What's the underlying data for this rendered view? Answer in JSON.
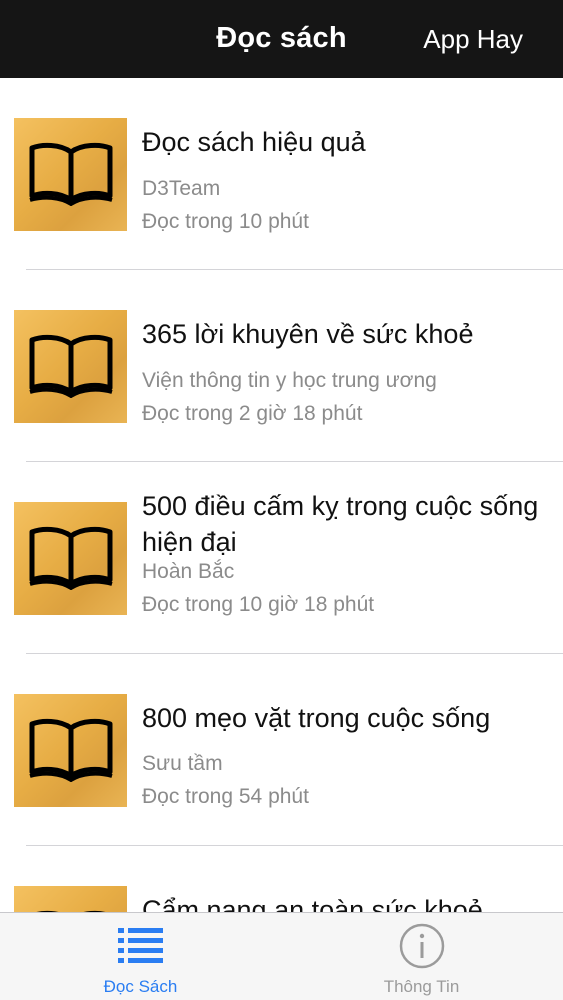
{
  "navbar": {
    "title": "Đọc sách",
    "right_button": "App Hay"
  },
  "books": [
    {
      "title": "Đọc sách hiệu quả",
      "author": "D3Team",
      "duration": "Đọc trong 10 phút",
      "cover_icon": "open-book-icon"
    },
    {
      "title": "365 lời khuyên về sức khoẻ",
      "author": "Viện thông tin y học trung ương",
      "duration": "Đọc trong 2 giờ 18 phút",
      "cover_icon": "open-book-icon"
    },
    {
      "title": "500 điều cấm kỵ trong cuộc sống hiện đại",
      "author": "Hoàn Bắc",
      "duration": "Đọc trong 10 giờ 18 phút",
      "cover_icon": "open-book-icon"
    },
    {
      "title": "800 mẹo vặt trong cuộc sống",
      "author": "Sưu tầm",
      "duration": "Đọc trong 54 phút",
      "cover_icon": "open-book-icon"
    },
    {
      "title": "Cẩm nang an toàn sức khoẻ",
      "author": "",
      "duration": "",
      "cover_icon": "open-book-icon"
    }
  ],
  "tabbar": {
    "tabs": [
      {
        "label": "Đọc Sách",
        "icon": "list-icon",
        "active": true
      },
      {
        "label": "Thông Tin",
        "icon": "info-icon",
        "active": false
      }
    ]
  },
  "colors": {
    "navbar_bg": "#151515",
    "accent": "#2a7df2",
    "secondary_text": "#8b8b8b",
    "cover_gold": "#e7ad45"
  }
}
